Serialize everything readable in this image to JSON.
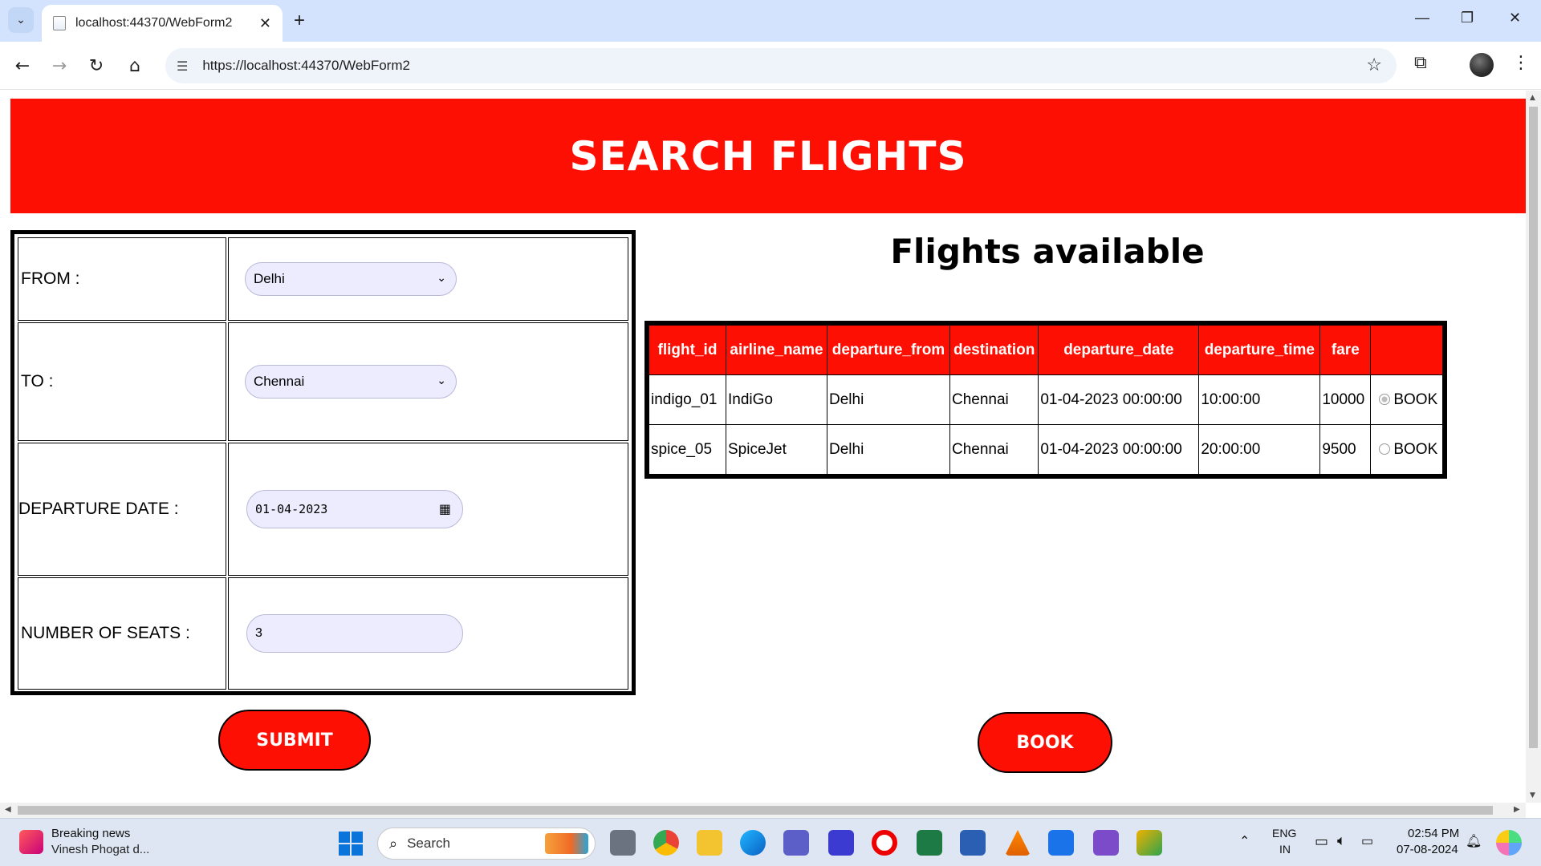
{
  "browser": {
    "tab_title": "localhost:44370/WebForm2",
    "url": "https://localhost:44370/WebForm2"
  },
  "page": {
    "banner_title": "SEARCH FLIGHTS",
    "form": {
      "from_label": "FROM :",
      "from_value": "Delhi",
      "to_label": "TO :",
      "to_value": "Chennai",
      "date_label": "DEPARTURE DATE :",
      "date_value": "01-04-2023",
      "seats_label": "NUMBER OF SEATS :",
      "seats_value": "3",
      "submit_label": "SUBMIT"
    },
    "flights_title": "Flights available",
    "table": {
      "headers": [
        "flight_id",
        "airline_name",
        "departure_from",
        "destination",
        "departure_date",
        "departure_time",
        "fare",
        ""
      ],
      "rows": [
        {
          "flight_id": "indigo_01",
          "airline_name": "IndiGo",
          "departure_from": "Delhi",
          "destination": "Chennai",
          "departure_date": "01-04-2023 00:00:00",
          "departure_time": "10:00:00",
          "fare": "10000",
          "book": "BOOK",
          "selected": true
        },
        {
          "flight_id": "spice_05",
          "airline_name": "SpiceJet",
          "departure_from": "Delhi",
          "destination": "Chennai",
          "departure_date": "01-04-2023 00:00:00",
          "departure_time": "20:00:00",
          "fare": "9500",
          "book": "BOOK",
          "selected": false
        }
      ]
    },
    "book_label": "BOOK"
  },
  "taskbar": {
    "news_title": "Breaking news",
    "news_sub": "Vinesh Phogat d...",
    "search_placeholder": "Search",
    "lang_top": "ENG",
    "lang_bottom": "IN",
    "time": "02:54 PM",
    "date": "07-08-2024"
  },
  "colors": {
    "banner_red": "#fe0f03",
    "input_bg": "#edecfe",
    "chrome_blue": "#d3e3fd"
  }
}
